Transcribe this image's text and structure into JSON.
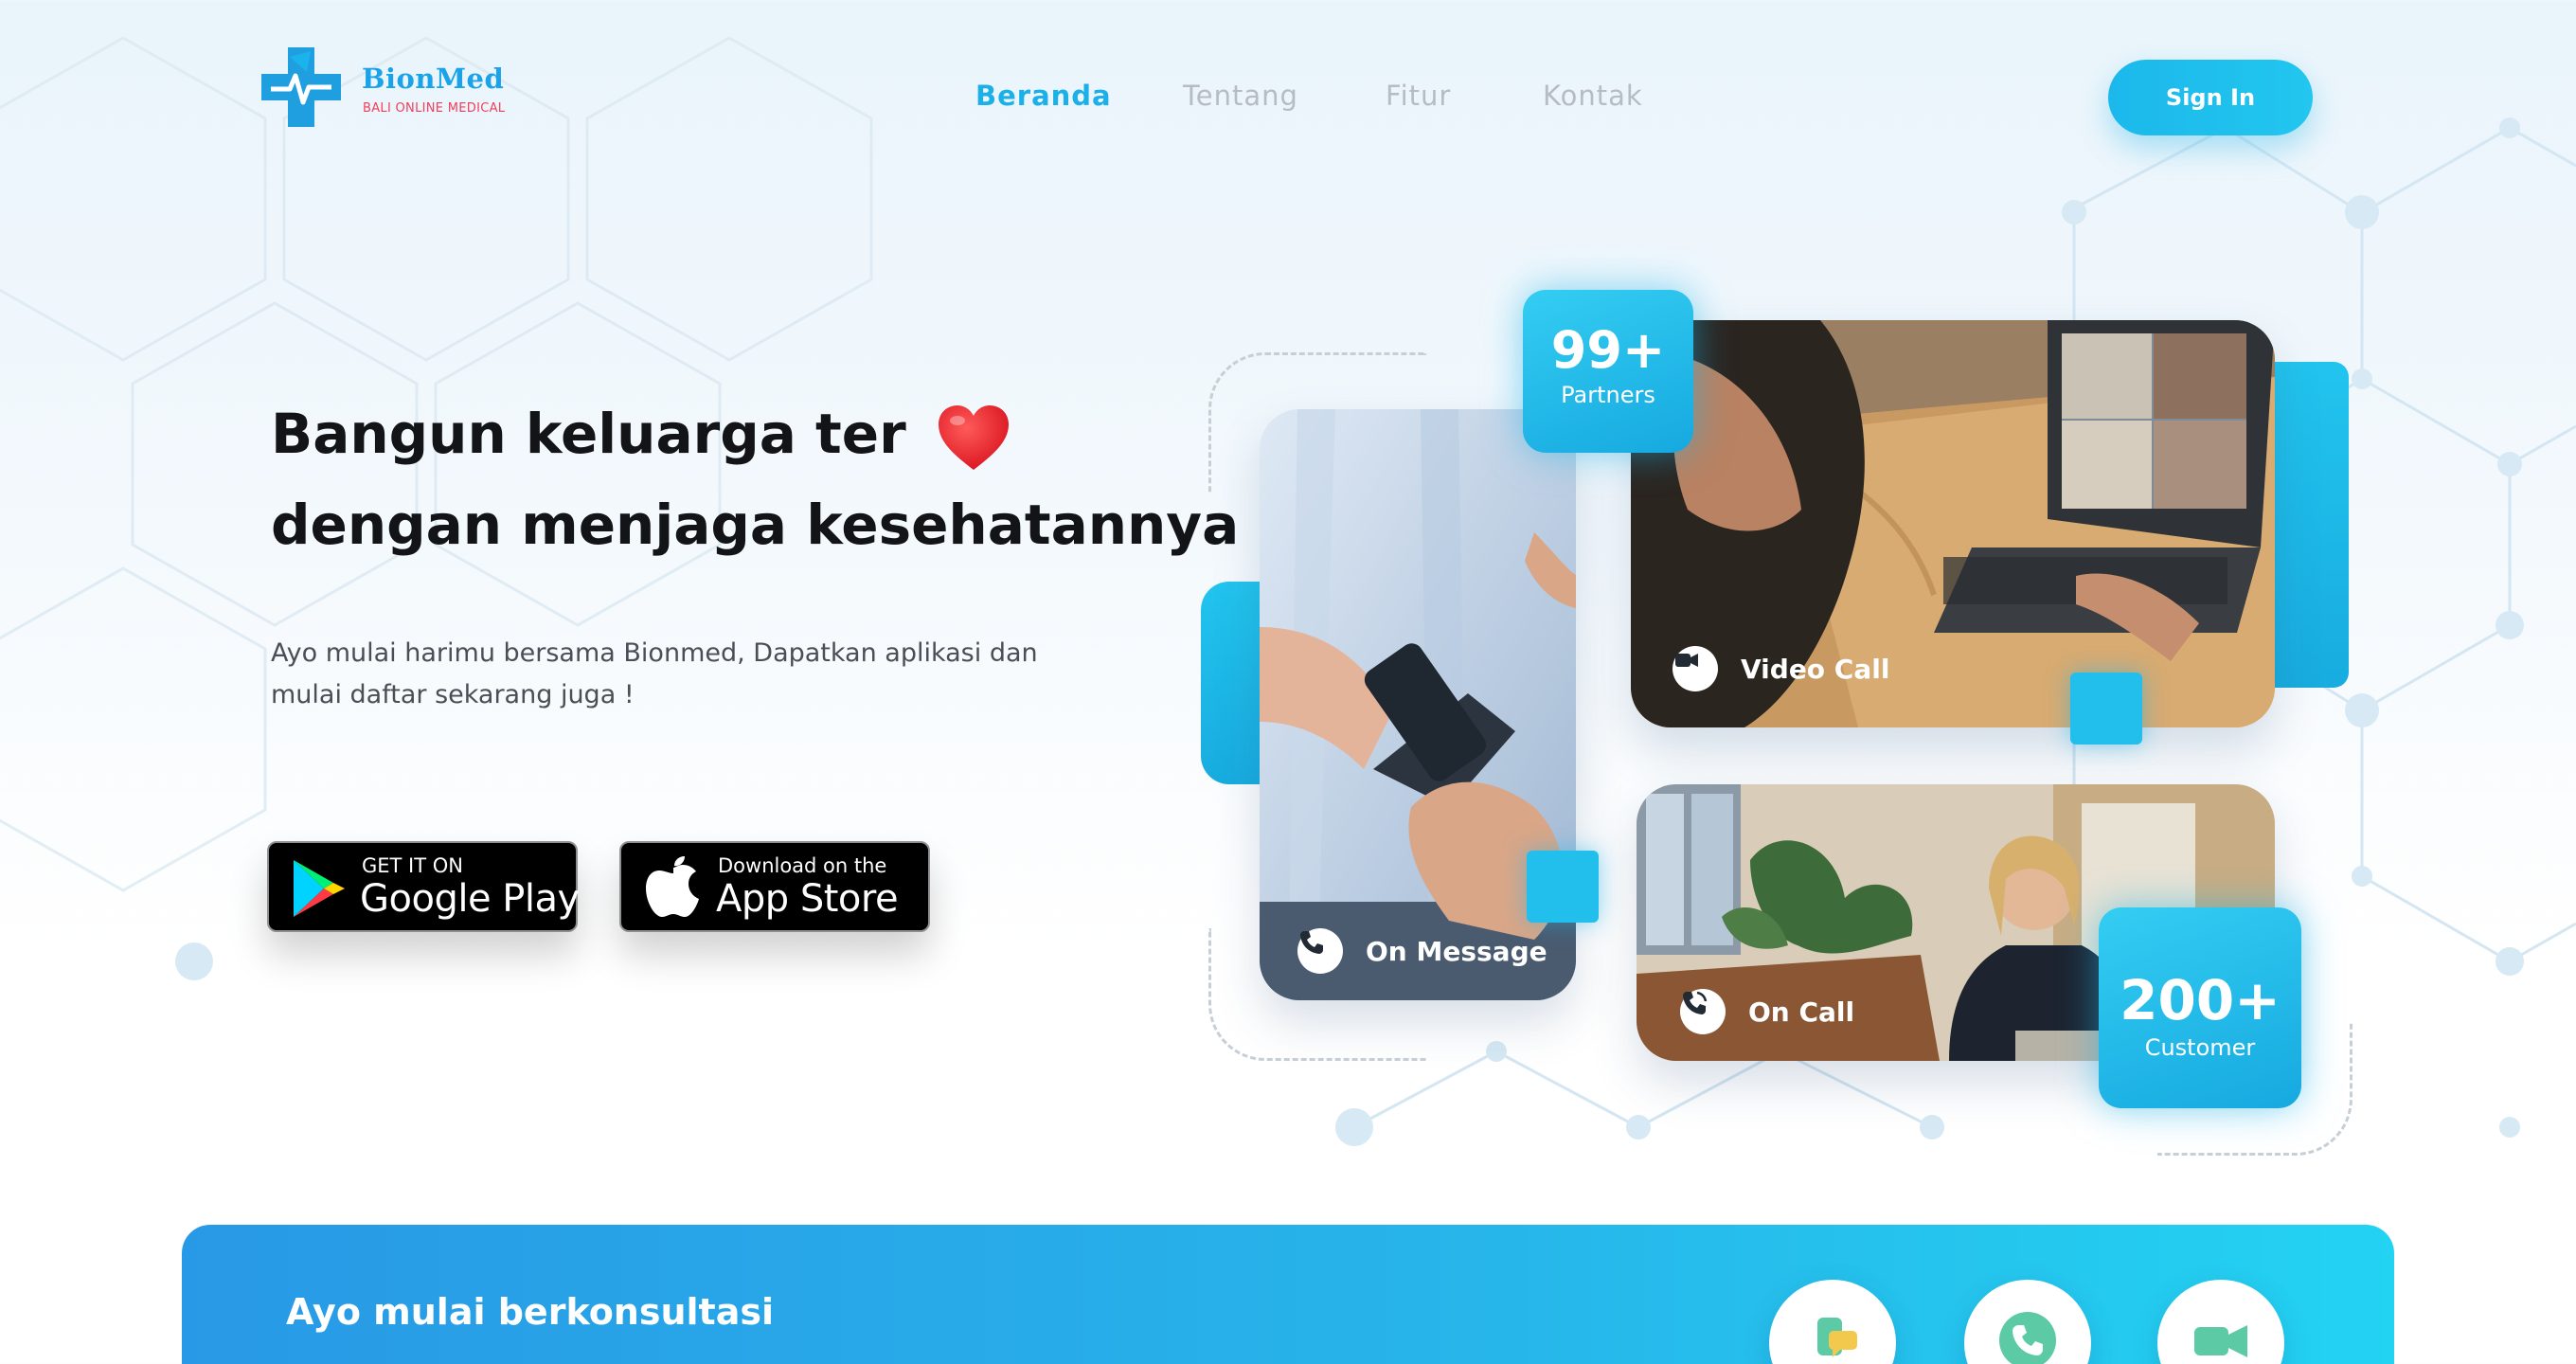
{
  "brand": {
    "name": "BionMed",
    "tagline": "BALI ONLINE MEDICAL",
    "colors": {
      "primary": "#1cb0e8",
      "accent_red": "#ef3f5a",
      "text_dark": "#121417"
    }
  },
  "nav": {
    "items": [
      {
        "label": "Beranda",
        "active": true
      },
      {
        "label": "Tentang",
        "active": false
      },
      {
        "label": "Fitur",
        "active": false
      },
      {
        "label": "Kontak",
        "active": false
      }
    ],
    "signin_label": "Sign In"
  },
  "hero": {
    "headline_line1": "Bangun keluarga ter",
    "headline_line2": "dengan menjaga kesehatannya",
    "headline_icon": "heart-icon",
    "subtext_line1": "Ayo mulai harimu bersama Bionmed, Dapatkan aplikasi dan",
    "subtext_line2": "mulai daftar sekarang juga !",
    "stores": {
      "google_play": {
        "small": "GET IT ON",
        "big": "Google Play"
      },
      "app_store": {
        "small": "Download on the",
        "big": "App Store"
      }
    }
  },
  "features": {
    "video_call": {
      "label": "Video Call",
      "icon": "video-camera-icon"
    },
    "on_message": {
      "label": "On Message",
      "icon": "phone-message-icon"
    },
    "on_call": {
      "label": "On Call",
      "icon": "phone-ringing-icon"
    }
  },
  "stats": {
    "partners": {
      "value": "99+",
      "label": "Partners"
    },
    "customers": {
      "value": "200+",
      "label": "Customer"
    }
  },
  "banner": {
    "title": "Ayo mulai berkonsultasi",
    "buttons": [
      "chat-icon",
      "phone-icon",
      "video-icon"
    ]
  }
}
